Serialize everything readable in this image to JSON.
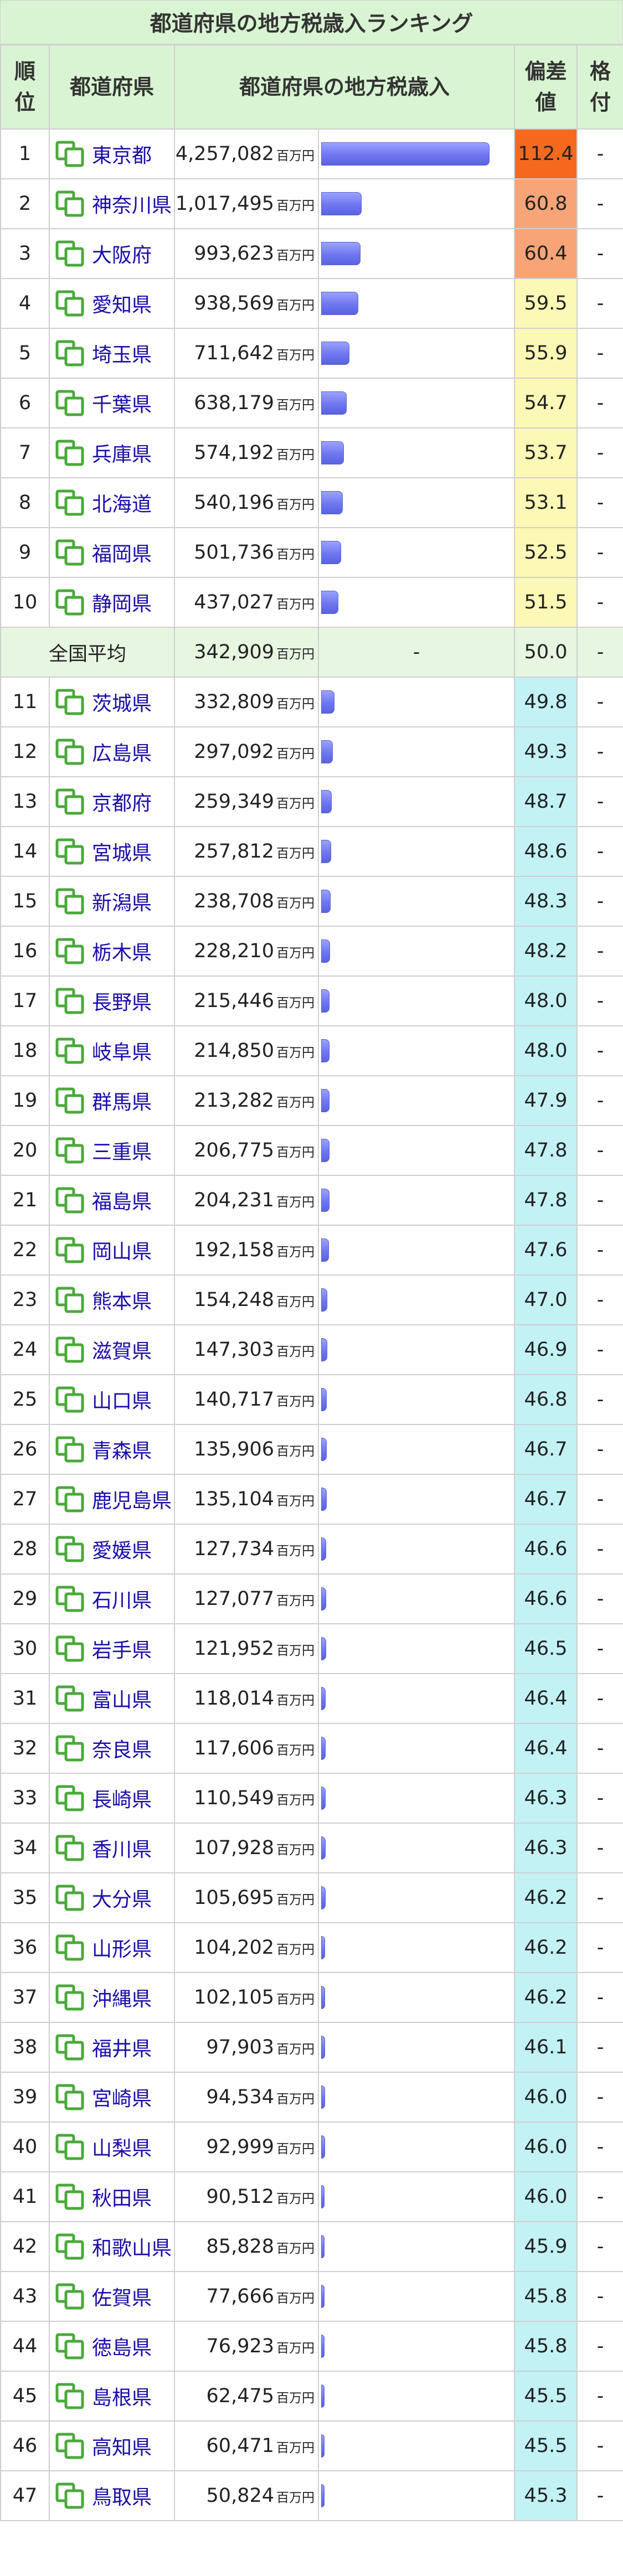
{
  "page": {
    "title": "都道府県の地方税歳入ランキング",
    "header": {
      "rank": "順位",
      "prefecture": "都道府県",
      "value": "都道府県の地方税歳入",
      "deviation": "偏差値",
      "grade": "格付"
    },
    "unit": "百万円",
    "colors": {
      "header_bg": "#d9f4d2",
      "average_row_bg": "#e6f6e1",
      "dev_top": "#f5691f",
      "dev_high": "#f8a477",
      "dev_mid": "#fcf8b5",
      "dev_low": "#c3f2f5",
      "link": "#1a0dab",
      "icon_green": "#4aa93a"
    },
    "average": {
      "label": "全国平均",
      "value": "342,909",
      "bar": "-",
      "deviation": "50.0",
      "grade": "-"
    },
    "rows": [
      {
        "rank": "1",
        "name": "東京都",
        "value": "4,257,082",
        "num": 4257082,
        "dev": "112.4",
        "grade": "-",
        "tier": "top"
      },
      {
        "rank": "2",
        "name": "神奈川県",
        "value": "1,017,495",
        "num": 1017495,
        "dev": "60.8",
        "grade": "-",
        "tier": "high"
      },
      {
        "rank": "3",
        "name": "大阪府",
        "value": "993,623",
        "num": 993623,
        "dev": "60.4",
        "grade": "-",
        "tier": "high"
      },
      {
        "rank": "4",
        "name": "愛知県",
        "value": "938,569",
        "num": 938569,
        "dev": "59.5",
        "grade": "-",
        "tier": "mid"
      },
      {
        "rank": "5",
        "name": "埼玉県",
        "value": "711,642",
        "num": 711642,
        "dev": "55.9",
        "grade": "-",
        "tier": "mid"
      },
      {
        "rank": "6",
        "name": "千葉県",
        "value": "638,179",
        "num": 638179,
        "dev": "54.7",
        "grade": "-",
        "tier": "mid"
      },
      {
        "rank": "7",
        "name": "兵庫県",
        "value": "574,192",
        "num": 574192,
        "dev": "53.7",
        "grade": "-",
        "tier": "mid"
      },
      {
        "rank": "8",
        "name": "北海道",
        "value": "540,196",
        "num": 540196,
        "dev": "53.1",
        "grade": "-",
        "tier": "mid"
      },
      {
        "rank": "9",
        "name": "福岡県",
        "value": "501,736",
        "num": 501736,
        "dev": "52.5",
        "grade": "-",
        "tier": "mid"
      },
      {
        "rank": "10",
        "name": "静岡県",
        "value": "437,027",
        "num": 437027,
        "dev": "51.5",
        "grade": "-",
        "tier": "mid"
      },
      {
        "rank": "11",
        "name": "茨城県",
        "value": "332,809",
        "num": 332809,
        "dev": "49.8",
        "grade": "-",
        "tier": "low"
      },
      {
        "rank": "12",
        "name": "広島県",
        "value": "297,092",
        "num": 297092,
        "dev": "49.3",
        "grade": "-",
        "tier": "low"
      },
      {
        "rank": "13",
        "name": "京都府",
        "value": "259,349",
        "num": 259349,
        "dev": "48.7",
        "grade": "-",
        "tier": "low"
      },
      {
        "rank": "14",
        "name": "宮城県",
        "value": "257,812",
        "num": 257812,
        "dev": "48.6",
        "grade": "-",
        "tier": "low"
      },
      {
        "rank": "15",
        "name": "新潟県",
        "value": "238,708",
        "num": 238708,
        "dev": "48.3",
        "grade": "-",
        "tier": "low"
      },
      {
        "rank": "16",
        "name": "栃木県",
        "value": "228,210",
        "num": 228210,
        "dev": "48.2",
        "grade": "-",
        "tier": "low"
      },
      {
        "rank": "17",
        "name": "長野県",
        "value": "215,446",
        "num": 215446,
        "dev": "48.0",
        "grade": "-",
        "tier": "low"
      },
      {
        "rank": "18",
        "name": "岐阜県",
        "value": "214,850",
        "num": 214850,
        "dev": "48.0",
        "grade": "-",
        "tier": "low"
      },
      {
        "rank": "19",
        "name": "群馬県",
        "value": "213,282",
        "num": 213282,
        "dev": "47.9",
        "grade": "-",
        "tier": "low"
      },
      {
        "rank": "20",
        "name": "三重県",
        "value": "206,775",
        "num": 206775,
        "dev": "47.8",
        "grade": "-",
        "tier": "low"
      },
      {
        "rank": "21",
        "name": "福島県",
        "value": "204,231",
        "num": 204231,
        "dev": "47.8",
        "grade": "-",
        "tier": "low"
      },
      {
        "rank": "22",
        "name": "岡山県",
        "value": "192,158",
        "num": 192158,
        "dev": "47.6",
        "grade": "-",
        "tier": "low"
      },
      {
        "rank": "23",
        "name": "熊本県",
        "value": "154,248",
        "num": 154248,
        "dev": "47.0",
        "grade": "-",
        "tier": "low"
      },
      {
        "rank": "24",
        "name": "滋賀県",
        "value": "147,303",
        "num": 147303,
        "dev": "46.9",
        "grade": "-",
        "tier": "low"
      },
      {
        "rank": "25",
        "name": "山口県",
        "value": "140,717",
        "num": 140717,
        "dev": "46.8",
        "grade": "-",
        "tier": "low"
      },
      {
        "rank": "26",
        "name": "青森県",
        "value": "135,906",
        "num": 135906,
        "dev": "46.7",
        "grade": "-",
        "tier": "low"
      },
      {
        "rank": "27",
        "name": "鹿児島県",
        "value": "135,104",
        "num": 135104,
        "dev": "46.7",
        "grade": "-",
        "tier": "low"
      },
      {
        "rank": "28",
        "name": "愛媛県",
        "value": "127,734",
        "num": 127734,
        "dev": "46.6",
        "grade": "-",
        "tier": "low"
      },
      {
        "rank": "29",
        "name": "石川県",
        "value": "127,077",
        "num": 127077,
        "dev": "46.6",
        "grade": "-",
        "tier": "low"
      },
      {
        "rank": "30",
        "name": "岩手県",
        "value": "121,952",
        "num": 121952,
        "dev": "46.5",
        "grade": "-",
        "tier": "low"
      },
      {
        "rank": "31",
        "name": "富山県",
        "value": "118,014",
        "num": 118014,
        "dev": "46.4",
        "grade": "-",
        "tier": "low"
      },
      {
        "rank": "32",
        "name": "奈良県",
        "value": "117,606",
        "num": 117606,
        "dev": "46.4",
        "grade": "-",
        "tier": "low"
      },
      {
        "rank": "33",
        "name": "長崎県",
        "value": "110,549",
        "num": 110549,
        "dev": "46.3",
        "grade": "-",
        "tier": "low"
      },
      {
        "rank": "34",
        "name": "香川県",
        "value": "107,928",
        "num": 107928,
        "dev": "46.3",
        "grade": "-",
        "tier": "low"
      },
      {
        "rank": "35",
        "name": "大分県",
        "value": "105,695",
        "num": 105695,
        "dev": "46.2",
        "grade": "-",
        "tier": "low"
      },
      {
        "rank": "36",
        "name": "山形県",
        "value": "104,202",
        "num": 104202,
        "dev": "46.2",
        "grade": "-",
        "tier": "low"
      },
      {
        "rank": "37",
        "name": "沖縄県",
        "value": "102,105",
        "num": 102105,
        "dev": "46.2",
        "grade": "-",
        "tier": "low"
      },
      {
        "rank": "38",
        "name": "福井県",
        "value": "97,903",
        "num": 97903,
        "dev": "46.1",
        "grade": "-",
        "tier": "low"
      },
      {
        "rank": "39",
        "name": "宮崎県",
        "value": "94,534",
        "num": 94534,
        "dev": "46.0",
        "grade": "-",
        "tier": "low"
      },
      {
        "rank": "40",
        "name": "山梨県",
        "value": "92,999",
        "num": 92999,
        "dev": "46.0",
        "grade": "-",
        "tier": "low"
      },
      {
        "rank": "41",
        "name": "秋田県",
        "value": "90,512",
        "num": 90512,
        "dev": "46.0",
        "grade": "-",
        "tier": "low"
      },
      {
        "rank": "42",
        "name": "和歌山県",
        "value": "85,828",
        "num": 85828,
        "dev": "45.9",
        "grade": "-",
        "tier": "low"
      },
      {
        "rank": "43",
        "name": "佐賀県",
        "value": "77,666",
        "num": 77666,
        "dev": "45.8",
        "grade": "-",
        "tier": "low"
      },
      {
        "rank": "44",
        "name": "徳島県",
        "value": "76,923",
        "num": 76923,
        "dev": "45.8",
        "grade": "-",
        "tier": "low"
      },
      {
        "rank": "45",
        "name": "島根県",
        "value": "62,475",
        "num": 62475,
        "dev": "45.5",
        "grade": "-",
        "tier": "low"
      },
      {
        "rank": "46",
        "name": "高知県",
        "value": "60,471",
        "num": 60471,
        "dev": "45.5",
        "grade": "-",
        "tier": "low"
      },
      {
        "rank": "47",
        "name": "鳥取県",
        "value": "50,824",
        "num": 50824,
        "dev": "45.3",
        "grade": "-",
        "tier": "low"
      }
    ]
  }
}
